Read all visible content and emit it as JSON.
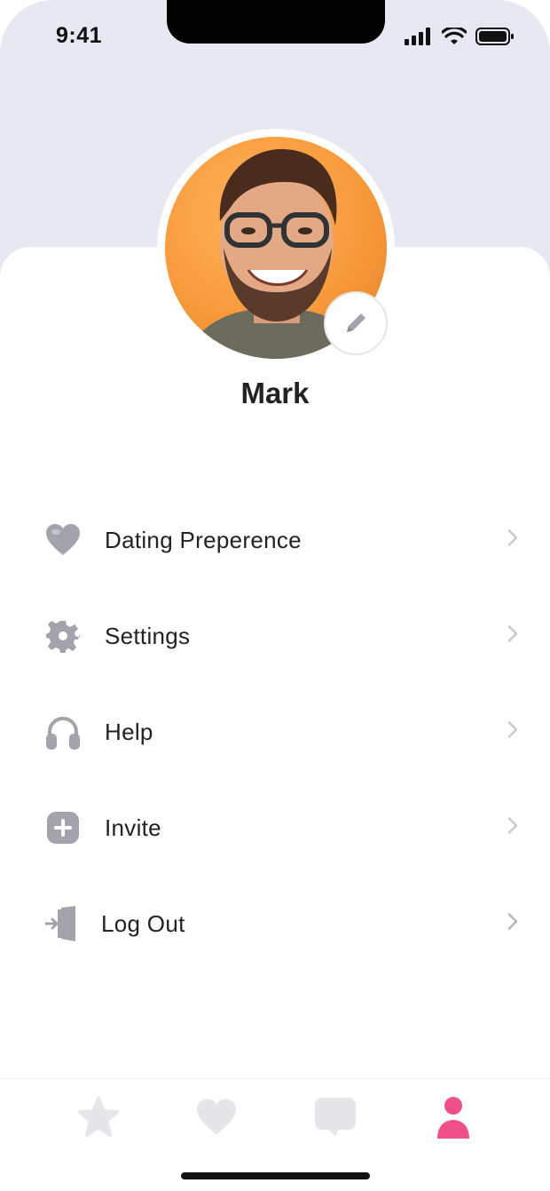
{
  "status_bar": {
    "time": "9:41"
  },
  "profile": {
    "name": "Mark",
    "edit_icon": "pencil-icon",
    "avatar_bg_color": "#f79a3c"
  },
  "menu": {
    "items": [
      {
        "label": "Dating Preperence",
        "icon": "heart-icon"
      },
      {
        "label": "Settings",
        "icon": "gear-icon"
      },
      {
        "label": "Help",
        "icon": "headphones-icon"
      },
      {
        "label": "Invite",
        "icon": "plus-square-icon"
      },
      {
        "label": "Log Out",
        "icon": "logout-icon"
      }
    ]
  },
  "tab_bar": {
    "tabs": [
      {
        "icon": "star-icon",
        "active": false
      },
      {
        "icon": "heart-icon",
        "active": false
      },
      {
        "icon": "chat-icon",
        "active": false
      },
      {
        "icon": "person-icon",
        "active": true
      }
    ]
  },
  "colors": {
    "accent": "#f0508a",
    "header_bg": "#e8e8f3",
    "icon_gray": "#a3a3ac",
    "tab_inactive": "#e6e6ea"
  }
}
